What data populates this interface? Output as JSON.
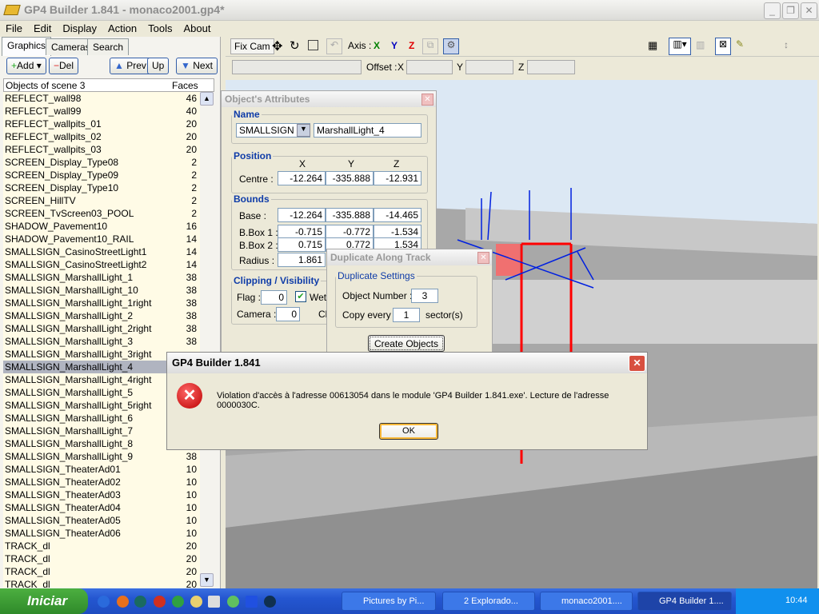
{
  "window": {
    "title": "GP4 Builder 1.841 - monaco2001.gp4*"
  },
  "menu": [
    "File",
    "Edit",
    "Display",
    "Action",
    "Tools",
    "About"
  ],
  "left": {
    "tabs": [
      "Graphics",
      "Cameras",
      "Search"
    ],
    "buttons": {
      "add": "Add",
      "del": "Del",
      "prev": "Prev",
      "up": "Up",
      "next": "Next"
    },
    "list_header": {
      "name": "Objects of scene 3",
      "faces": "Faces"
    },
    "rows": [
      {
        "name": "REFLECT_wall98",
        "faces": "46"
      },
      {
        "name": "REFLECT_wall99",
        "faces": "40"
      },
      {
        "name": "REFLECT_wallpits_01",
        "faces": "20"
      },
      {
        "name": "REFLECT_wallpits_02",
        "faces": "20"
      },
      {
        "name": "REFLECT_wallpits_03",
        "faces": "20"
      },
      {
        "name": "SCREEN_Display_Type08",
        "faces": "2"
      },
      {
        "name": "SCREEN_Display_Type09",
        "faces": "2"
      },
      {
        "name": "SCREEN_Display_Type10",
        "faces": "2"
      },
      {
        "name": "SCREEN_HillTV",
        "faces": "2"
      },
      {
        "name": "SCREEN_TvScreen03_POOL",
        "faces": "2"
      },
      {
        "name": "SHADOW_Pavement10",
        "faces": "16"
      },
      {
        "name": "SHADOW_Pavement10_RAIL",
        "faces": "14"
      },
      {
        "name": "SMALLSIGN_CasinoStreetLight1",
        "faces": "14"
      },
      {
        "name": "SMALLSIGN_CasinoStreetLight2",
        "faces": "14"
      },
      {
        "name": "SMALLSIGN_MarshallLight_1",
        "faces": "38"
      },
      {
        "name": "SMALLSIGN_MarshallLight_10",
        "faces": "38"
      },
      {
        "name": "SMALLSIGN_MarshallLight_1right",
        "faces": "38"
      },
      {
        "name": "SMALLSIGN_MarshallLight_2",
        "faces": "38"
      },
      {
        "name": "SMALLSIGN_MarshallLight_2right",
        "faces": "38"
      },
      {
        "name": "SMALLSIGN_MarshallLight_3",
        "faces": "38"
      },
      {
        "name": "SMALLSIGN_MarshallLight_3right",
        "faces": ""
      },
      {
        "name": "SMALLSIGN_MarshallLight_4",
        "faces": "",
        "selected": true
      },
      {
        "name": "SMALLSIGN_MarshallLight_4right",
        "faces": ""
      },
      {
        "name": "SMALLSIGN_MarshallLight_5",
        "faces": ""
      },
      {
        "name": "SMALLSIGN_MarshallLight_5right",
        "faces": ""
      },
      {
        "name": "SMALLSIGN_MarshallLight_6",
        "faces": ""
      },
      {
        "name": "SMALLSIGN_MarshallLight_7",
        "faces": ""
      },
      {
        "name": "SMALLSIGN_MarshallLight_8",
        "faces": ""
      },
      {
        "name": "SMALLSIGN_MarshallLight_9",
        "faces": "38"
      },
      {
        "name": "SMALLSIGN_TheaterAd01",
        "faces": "10"
      },
      {
        "name": "SMALLSIGN_TheaterAd02",
        "faces": "10"
      },
      {
        "name": "SMALLSIGN_TheaterAd03",
        "faces": "10"
      },
      {
        "name": "SMALLSIGN_TheaterAd04",
        "faces": "10"
      },
      {
        "name": "SMALLSIGN_TheaterAd05",
        "faces": "10"
      },
      {
        "name": "SMALLSIGN_TheaterAd06",
        "faces": "10"
      },
      {
        "name": "TRACK_dl",
        "faces": "20"
      },
      {
        "name": "TRACK_dl",
        "faces": "20"
      },
      {
        "name": "TRACK_dl",
        "faces": "20"
      },
      {
        "name": "TRACK_dl",
        "faces": "20"
      }
    ]
  },
  "toolbar": {
    "fixcam": "Fix Cam",
    "axis_label": "Axis :",
    "x": "X",
    "y": "Y",
    "z": "Z",
    "offset_label": "Offset :",
    "ox": "X",
    "oy": "Y",
    "oz": "Z",
    "colors": {
      "x": "#008000",
      "y": "#0000c0",
      "z": "#e00000"
    }
  },
  "attributes": {
    "title": "Object's Attributes",
    "name_group": "Name",
    "type": "SMALLSIGN",
    "name": "MarshallLight_4",
    "position_group": "Position",
    "col_x": "X",
    "col_y": "Y",
    "col_z": "Z",
    "centre_label": "Centre :",
    "centre": [
      "-12.264",
      "-335.888",
      "-12.931"
    ],
    "bounds_group": "Bounds",
    "base_label": "Base :",
    "base": [
      "-12.264",
      "-335.888",
      "-14.465"
    ],
    "bbox1_label": "B.Box 1 :",
    "bbox1": [
      "-0.715",
      "-0.772",
      "-1.534"
    ],
    "bbox2_label": "B.Box 2 :",
    "bbox2": [
      "0.715",
      "0.772",
      "1.534"
    ],
    "radius_label": "Radius :",
    "radius": "1.861",
    "clip_group": "Clipping / Visibility",
    "flag_label": "Flag :",
    "flag": "0",
    "wet_label": "Wet",
    "wet_checked": true,
    "camera_label": "Camera :",
    "camera": "0",
    "cli_label": "Cli"
  },
  "duplicate": {
    "title": "Duplicate Along Track",
    "group": "Duplicate Settings",
    "number_label": "Object Number :",
    "number": "3",
    "copy_label": "Copy every",
    "copy": "1",
    "sector_label": "sector(s)",
    "create": "Create Objects"
  },
  "error": {
    "title": "GP4 Builder 1.841",
    "message": "Violation d'accès à l'adresse 00613054 dans le module 'GP4 Builder 1.841.exe'. Lecture de l'adresse 0000030C.",
    "ok": "OK"
  },
  "taskbar": {
    "start": "Iniciar",
    "tasks": [
      "Pictures by Pi...",
      "2 Explorado...",
      "monaco2001....",
      "GP4 Builder 1...."
    ],
    "clock": "10:44"
  }
}
